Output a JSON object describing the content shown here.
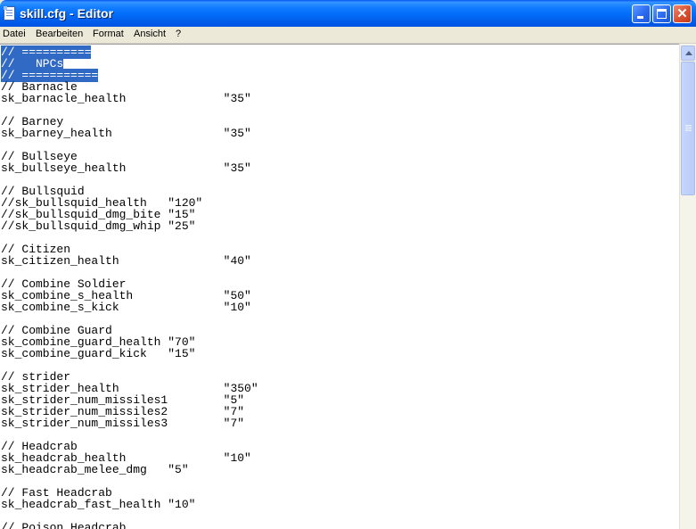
{
  "window": {
    "title": "skill.cfg - Editor",
    "buttons": {
      "minimize": "minimize-icon",
      "maximize": "maximize-icon",
      "close": "close-icon"
    }
  },
  "menu": {
    "items": [
      "Datei",
      "Bearbeiten",
      "Format",
      "Ansicht",
      "?"
    ]
  },
  "editor": {
    "lines": [
      {
        "text": "// ==========",
        "selected": true
      },
      {
        "text": "//   NPCs",
        "selected": true
      },
      {
        "text": "// ===========",
        "selected": true
      },
      {
        "text": "// Barnacle"
      },
      {
        "text": "sk_barnacle_health              \"35\""
      },
      {
        "text": ""
      },
      {
        "text": "// Barney"
      },
      {
        "text": "sk_barney_health                \"35\""
      },
      {
        "text": ""
      },
      {
        "text": "// Bullseye"
      },
      {
        "text": "sk_bullseye_health              \"35\""
      },
      {
        "text": ""
      },
      {
        "text": "// Bullsquid"
      },
      {
        "text": "//sk_bullsquid_health   \"120\""
      },
      {
        "text": "//sk_bullsquid_dmg_bite \"15\""
      },
      {
        "text": "//sk_bullsquid_dmg_whip \"25\""
      },
      {
        "text": ""
      },
      {
        "text": "// Citizen"
      },
      {
        "text": "sk_citizen_health               \"40\""
      },
      {
        "text": ""
      },
      {
        "text": "// Combine Soldier"
      },
      {
        "text": "sk_combine_s_health             \"50\""
      },
      {
        "text": "sk_combine_s_kick               \"10\""
      },
      {
        "text": ""
      },
      {
        "text": "// Combine Guard"
      },
      {
        "text": "sk_combine_guard_health \"70\""
      },
      {
        "text": "sk_combine_guard_kick   \"15\""
      },
      {
        "text": ""
      },
      {
        "text": "// strider"
      },
      {
        "text": "sk_strider_health               \"350\""
      },
      {
        "text": "sk_strider_num_missiles1        \"5\""
      },
      {
        "text": "sk_strider_num_missiles2        \"7\""
      },
      {
        "text": "sk_strider_num_missiles3        \"7\""
      },
      {
        "text": ""
      },
      {
        "text": "// Headcrab"
      },
      {
        "text": "sk_headcrab_health              \"10\""
      },
      {
        "text": "sk_headcrab_melee_dmg   \"5\""
      },
      {
        "text": ""
      },
      {
        "text": "// Fast Headcrab"
      },
      {
        "text": "sk_headcrab_fast_health \"10\""
      },
      {
        "text": ""
      },
      {
        "text": "// Poison Headcrab"
      }
    ]
  },
  "colors": {
    "titlebar": "#0054e3",
    "selection": "#316ac5",
    "menubar": "#ece9d8"
  }
}
